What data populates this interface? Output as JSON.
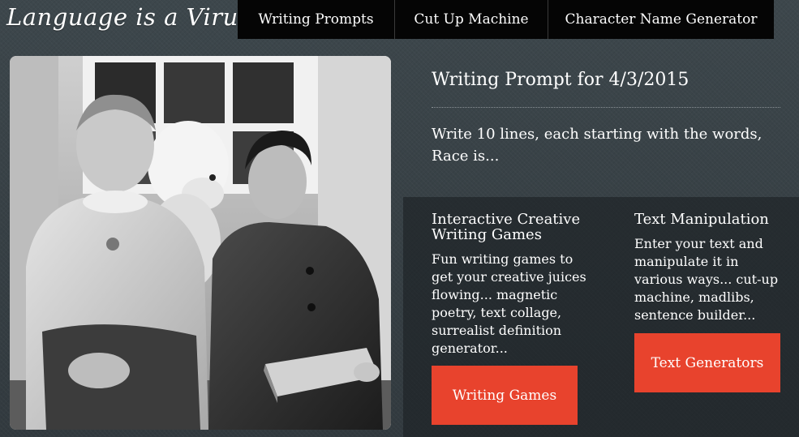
{
  "header": {
    "logo": "Language is a Virus",
    "nav": [
      {
        "label": "Writing Prompts"
      },
      {
        "label": "Cut Up Machine"
      },
      {
        "label": "Character Name Generator"
      }
    ]
  },
  "photo": {
    "description": "Black and white photograph of two women seated with a white poodle behind them",
    "image_name": "portrait-photo"
  },
  "prompt": {
    "heading": "Writing Prompt for 4/3/2015",
    "text": "Write 10 lines, each starting with the words, Race is..."
  },
  "features": {
    "games": {
      "title": "Interactive Creative Writing Games",
      "description": "Fun writing games to get your creative juices flowing... magnetic poetry, text collage, surrealist definition generator...",
      "button": "Writing Games"
    },
    "text": {
      "title": "Text Manipulation",
      "description": "Enter your text and manipulate it in various ways... cut-up machine, madlibs, sentence builder...",
      "button": "Text Generators"
    }
  },
  "colors": {
    "background": "#343c41",
    "nav_bg": "#050505",
    "button": "#e8432d",
    "text": "#ffffff"
  }
}
